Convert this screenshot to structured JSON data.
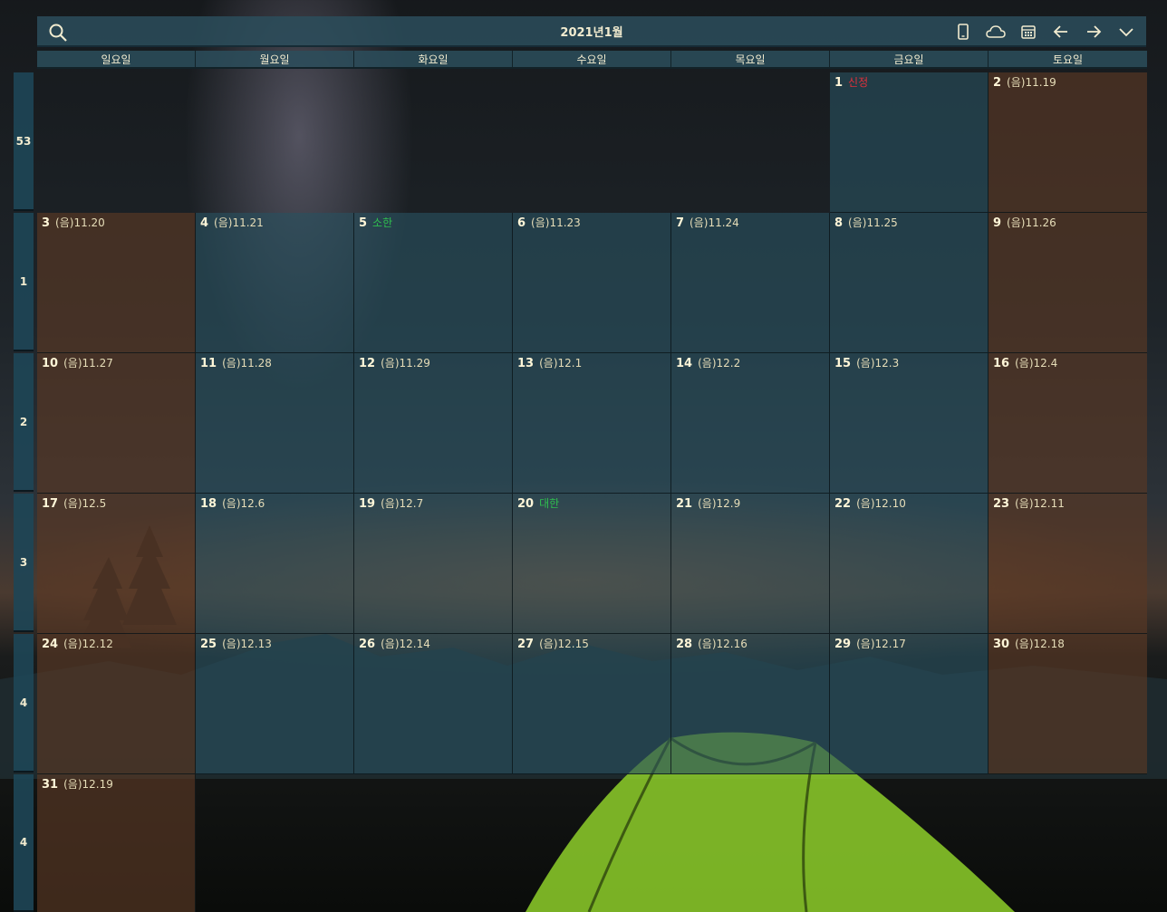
{
  "header": {
    "title": "2021년1월"
  },
  "weekdays": [
    "일요일",
    "월요일",
    "화요일",
    "수요일",
    "목요일",
    "금요일",
    "토요일"
  ],
  "week_numbers": [
    "53",
    "1",
    "2",
    "3",
    "4",
    "4"
  ],
  "weeks": [
    [
      null,
      null,
      null,
      null,
      null,
      {
        "day": "1",
        "lunar": "신정",
        "style": "holiday-red"
      },
      {
        "day": "2",
        "lunar": "(음)11.19"
      }
    ],
    [
      {
        "day": "3",
        "lunar": "(음)11.20"
      },
      {
        "day": "4",
        "lunar": "(음)11.21"
      },
      {
        "day": "5",
        "lunar": "소한",
        "style": "term-green"
      },
      {
        "day": "6",
        "lunar": "(음)11.23"
      },
      {
        "day": "7",
        "lunar": "(음)11.24"
      },
      {
        "day": "8",
        "lunar": "(음)11.25"
      },
      {
        "day": "9",
        "lunar": "(음)11.26"
      }
    ],
    [
      {
        "day": "10",
        "lunar": "(음)11.27"
      },
      {
        "day": "11",
        "lunar": "(음)11.28"
      },
      {
        "day": "12",
        "lunar": "(음)11.29"
      },
      {
        "day": "13",
        "lunar": "(음)12.1"
      },
      {
        "day": "14",
        "lunar": "(음)12.2"
      },
      {
        "day": "15",
        "lunar": "(음)12.3"
      },
      {
        "day": "16",
        "lunar": "(음)12.4"
      }
    ],
    [
      {
        "day": "17",
        "lunar": "(음)12.5"
      },
      {
        "day": "18",
        "lunar": "(음)12.6"
      },
      {
        "day": "19",
        "lunar": "(음)12.7"
      },
      {
        "day": "20",
        "lunar": "대한",
        "style": "term-green"
      },
      {
        "day": "21",
        "lunar": "(음)12.9"
      },
      {
        "day": "22",
        "lunar": "(음)12.10"
      },
      {
        "day": "23",
        "lunar": "(음)12.11"
      }
    ],
    [
      {
        "day": "24",
        "lunar": "(음)12.12"
      },
      {
        "day": "25",
        "lunar": "(음)12.13"
      },
      {
        "day": "26",
        "lunar": "(음)12.14"
      },
      {
        "day": "27",
        "lunar": "(음)12.15"
      },
      {
        "day": "28",
        "lunar": "(음)12.16"
      },
      {
        "day": "29",
        "lunar": "(음)12.17"
      },
      {
        "day": "30",
        "lunar": "(음)12.18"
      }
    ],
    [
      {
        "day": "31",
        "lunar": "(음)12.19"
      },
      null,
      null,
      null,
      null,
      null,
      null
    ]
  ],
  "toolbar_icons": [
    "phone-icon",
    "cloud-icon",
    "calendar-icon",
    "arrow-left-icon",
    "arrow-right-icon",
    "chevron-down-icon"
  ],
  "colors": {
    "weekday_cell": "#285060",
    "weekend_cell": "#5a3824",
    "holiday_text": "#e0303a",
    "solar_term_text": "#2fbf4f"
  }
}
